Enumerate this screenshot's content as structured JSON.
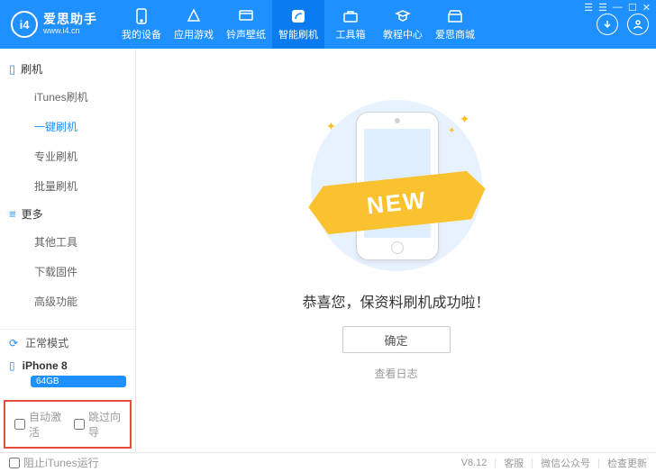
{
  "brand": {
    "badge": "i4",
    "name": "爱思助手",
    "url": "www.i4.cn"
  },
  "nav": {
    "items": [
      {
        "id": "device",
        "label": "我的设备"
      },
      {
        "id": "apps",
        "label": "应用游戏"
      },
      {
        "id": "ringtone",
        "label": "铃声壁纸"
      },
      {
        "id": "flash",
        "label": "智能刷机"
      },
      {
        "id": "toolbox",
        "label": "工具箱"
      },
      {
        "id": "tutorial",
        "label": "教程中心"
      },
      {
        "id": "store",
        "label": "爱思商城"
      }
    ],
    "active": "flash"
  },
  "sidebar": {
    "groups": [
      {
        "title": "刷机",
        "items": [
          {
            "id": "itunes",
            "label": "iTunes刷机"
          },
          {
            "id": "onekey",
            "label": "一键刷机"
          },
          {
            "id": "pro",
            "label": "专业刷机"
          },
          {
            "id": "batch",
            "label": "批量刷机"
          }
        ]
      },
      {
        "title": "更多",
        "items": [
          {
            "id": "other",
            "label": "其他工具"
          },
          {
            "id": "firmware",
            "label": "下载固件"
          },
          {
            "id": "advanced",
            "label": "高级功能"
          }
        ]
      }
    ],
    "active": "onekey",
    "status": {
      "mode_label": "正常模式"
    },
    "device": {
      "name": "iPhone 8",
      "capacity": "64GB"
    },
    "options": {
      "auto_activate": "自动激活",
      "skip_wizard": "跳过向导"
    }
  },
  "content": {
    "ribbon": "NEW",
    "message": "恭喜您，保资料刷机成功啦！",
    "ok_label": "确定",
    "log_link": "查看日志"
  },
  "footer": {
    "block_itunes": "阻止iTunes运行",
    "version": "V8.12",
    "support": "客服",
    "wechat": "微信公众号",
    "update": "检查更新"
  }
}
